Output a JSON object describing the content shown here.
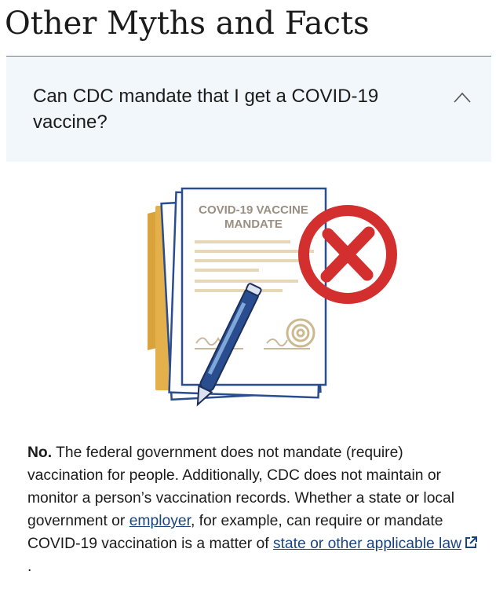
{
  "page": {
    "title": "Other Myths and Facts"
  },
  "accordion": {
    "question": "Can CDC mandate that I get a COVID-19 vaccine?",
    "expanded": true,
    "icon": "chevron-up-icon"
  },
  "illustration": {
    "document_title_line1": "COVID-19 VACCINE",
    "document_title_line2": "MANDATE",
    "icons": [
      "document-icon",
      "folder-icon",
      "pen-icon",
      "seal-icon",
      "x-mark-icon"
    ]
  },
  "answer": {
    "lead": "No.",
    "text1": " The federal government does not mandate (require) vaccination for people. Additionally, CDC does not maintain or monitor a person’s vaccination records. Whether a state or local government or ",
    "link_employer": "employer",
    "text2": ", for example, can require or mandate COVID-19 vaccination is a matter of ",
    "link_law": "state or other applicable law",
    "text3": " ."
  },
  "colors": {
    "accent_line": "#3b8cb1",
    "accordion_bg": "#f1f7fa",
    "link": "#1a4480",
    "x_red": "#d32f2f",
    "doc_outline": "#2a4d8f",
    "folder": "#d9a23a"
  }
}
